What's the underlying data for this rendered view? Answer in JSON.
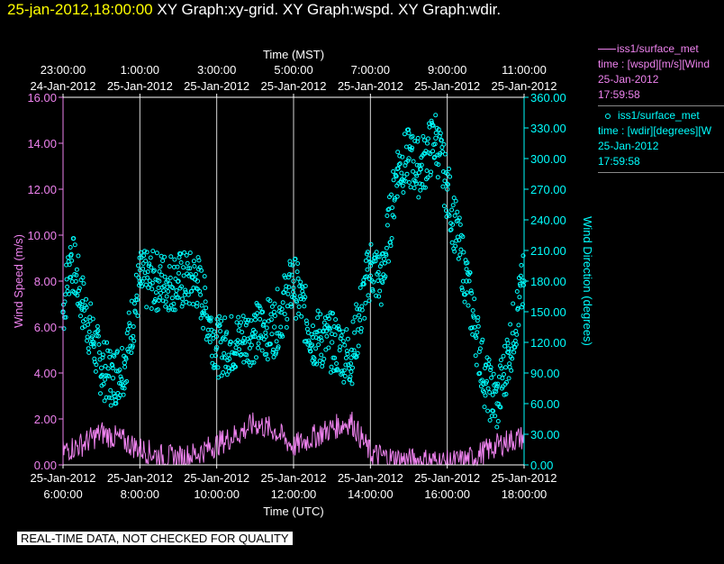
{
  "header": {
    "timestamp": "25-jan-2012,18:00:00",
    "graphs": "XY Graph:xy-grid.  XY Graph:wspd.  XY Graph:wdir."
  },
  "legend": {
    "wspd": {
      "name": "iss1/surface_met",
      "desc": "time : [wspd][m/s][Wind",
      "date": "25-Jan-2012",
      "time": "17:59:58",
      "color": "#ee82ee"
    },
    "wdir": {
      "name": "iss1/surface_met",
      "desc": "time : [wdir][degrees][W",
      "date": "25-Jan-2012",
      "time": "17:59:58",
      "color": "#00ffff"
    }
  },
  "notice": "REAL-TIME DATA, NOT CHECKED FOR QUALITY",
  "chart_data": {
    "type": "line",
    "top_axis": {
      "label": "Time (MST)",
      "ticks": [
        {
          "time": "23:00:00",
          "date": "24-Jan-2012"
        },
        {
          "time": "1:00:00",
          "date": "25-Jan-2012"
        },
        {
          "time": "3:00:00",
          "date": "25-Jan-2012"
        },
        {
          "time": "5:00:00",
          "date": "25-Jan-2012"
        },
        {
          "time": "7:00:00",
          "date": "25-Jan-2012"
        },
        {
          "time": "9:00:00",
          "date": "25-Jan-2012"
        },
        {
          "time": "11:00:00",
          "date": "25-Jan-2012"
        }
      ]
    },
    "bottom_axis": {
      "label": "Time (UTC)",
      "ticks": [
        {
          "date": "25-Jan-2012",
          "time": "6:00:00"
        },
        {
          "date": "25-Jan-2012",
          "time": "8:00:00"
        },
        {
          "date": "25-Jan-2012",
          "time": "10:00:00"
        },
        {
          "date": "25-Jan-2012",
          "time": "12:00:00"
        },
        {
          "date": "25-Jan-2012",
          "time": "14:00:00"
        },
        {
          "date": "25-Jan-2012",
          "time": "16:00:00"
        },
        {
          "date": "25-Jan-2012",
          "time": "18:00:00"
        }
      ]
    },
    "x_range_utc_hours": [
      6,
      18
    ],
    "left_axis": {
      "label": "Wind Speed (m/s)",
      "range": [
        0,
        16
      ],
      "ticks": [
        "0.00",
        "2.00",
        "4.00",
        "6.00",
        "8.00",
        "10.00",
        "12.00",
        "14.00",
        "16.00"
      ]
    },
    "right_axis": {
      "label": "Wind Direction (degrees)",
      "range": [
        0,
        360
      ],
      "ticks": [
        "0.00",
        "30.00",
        "60.00",
        "90.00",
        "120.00",
        "150.00",
        "180.00",
        "210.00",
        "240.00",
        "270.00",
        "300.00",
        "330.00",
        "360.00"
      ]
    },
    "grid": "vertical lines at each 2-hour tick",
    "series": [
      {
        "name": "iss1/surface_met wspd",
        "axis": "left",
        "style": "line",
        "color": "#ee82ee",
        "x": [
          6.0,
          6.5,
          7.0,
          7.5,
          8.0,
          8.5,
          9.0,
          9.5,
          10.0,
          10.5,
          11.0,
          11.5,
          12.0,
          12.5,
          13.0,
          13.5,
          14.0,
          14.5,
          15.0,
          15.5,
          16.0,
          16.5,
          17.0,
          17.5,
          18.0
        ],
        "y": [
          0.6,
          0.9,
          1.4,
          1.1,
          0.7,
          0.4,
          0.3,
          0.5,
          0.9,
          1.3,
          1.8,
          1.5,
          0.8,
          1.2,
          1.6,
          1.9,
          0.5,
          0.3,
          0.2,
          0.2,
          0.1,
          0.2,
          0.6,
          1.0,
          1.2
        ]
      },
      {
        "name": "iss1/surface_met wdir",
        "axis": "right",
        "style": "points",
        "color": "#00ffff",
        "x": [
          6.0,
          6.2,
          6.5,
          6.8,
          7.0,
          7.3,
          7.6,
          8.0,
          8.5,
          9.0,
          9.5,
          10.0,
          10.5,
          11.0,
          11.5,
          12.0,
          12.5,
          13.0,
          13.5,
          14.0,
          14.3,
          14.7,
          15.0,
          15.3,
          15.7,
          16.0,
          16.5,
          17.0,
          17.3,
          17.6,
          18.0
        ],
        "y": [
          150,
          205,
          160,
          120,
          95,
          85,
          100,
          180,
          180,
          180,
          180,
          115,
          120,
          130,
          135,
          180,
          125,
          120,
          105,
          195,
          180,
          290,
          300,
          290,
          320,
          270,
          180,
          80,
          60,
          110,
          180
        ]
      }
    ]
  }
}
